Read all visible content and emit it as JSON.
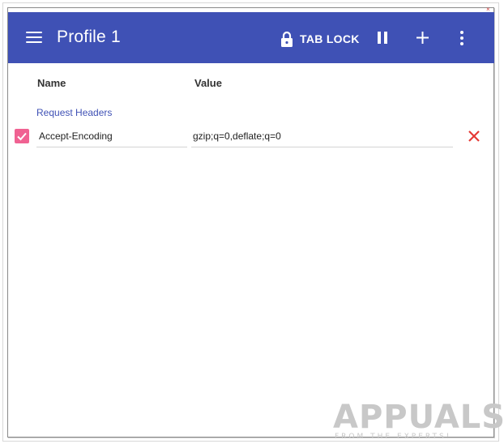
{
  "toolbar": {
    "title": "Profile 1",
    "tab_lock_label": "TAB LOCK",
    "background_color": "#3f51b5",
    "icons": [
      "menu-icon",
      "lock-icon",
      "pause-icon",
      "add-icon",
      "more-vert-icon"
    ]
  },
  "columns": {
    "name_label": "Name",
    "value_label": "Value"
  },
  "section": {
    "title": "Request Headers"
  },
  "headers": [
    {
      "enabled": true,
      "name": "Accept-Encoding",
      "value": "gzip;q=0,deflate;q=0"
    }
  ],
  "colors": {
    "accent": "#3f51b5",
    "checkbox": "#f06292",
    "delete": "#e53935"
  },
  "watermark": {
    "text": "APPUALS",
    "subtext": "FROM THE EXPERTS!"
  }
}
